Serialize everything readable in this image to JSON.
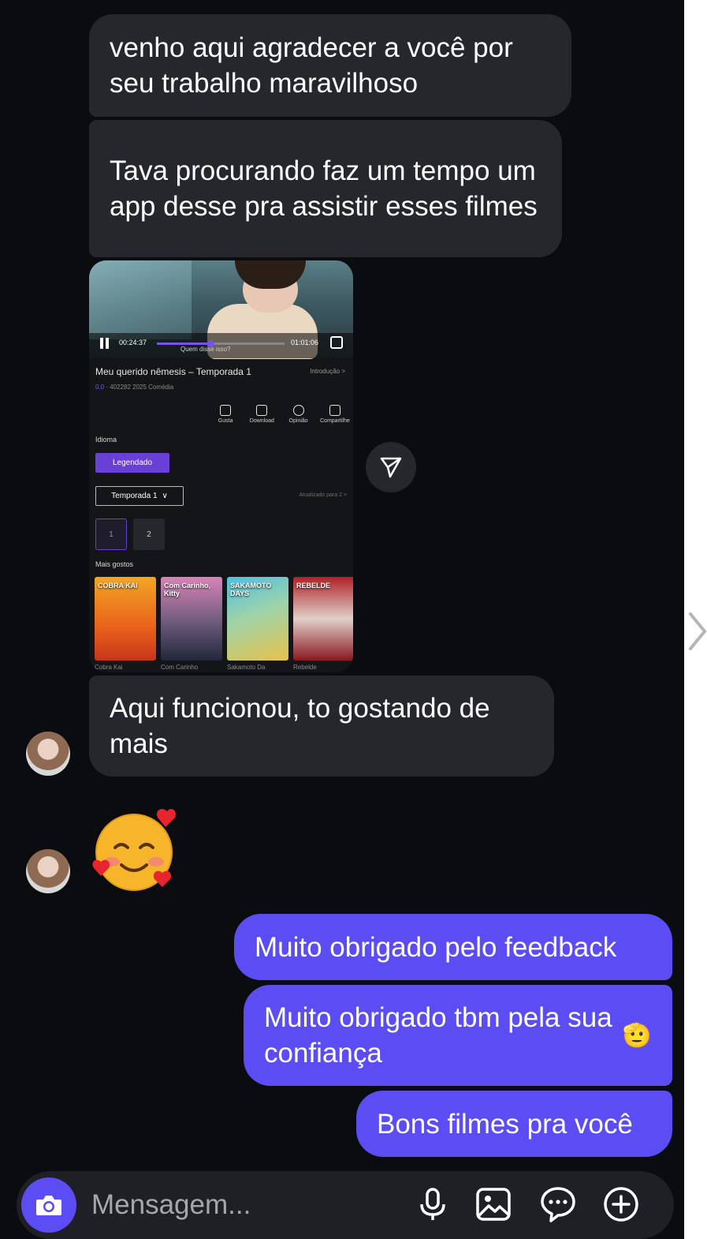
{
  "messages_incoming": [
    "venho aqui agradecer a você por seu trabalho maravilhoso",
    "Tava procurando faz um tempo um app desse pra assistir esses filmes",
    "Aqui funcionou, to gostando de mais"
  ],
  "reaction_emoji": "smiling-face-with-hearts",
  "messages_outgoing": [
    "Muito obrigado pelo feedback",
    "Muito obrigado tbm pela sua confiança",
    "Bons filmes pra você"
  ],
  "outgoing_emoji": "🫡",
  "shared_screenshot": {
    "video": {
      "elapsed": "00:24:37",
      "duration": "01:01:06",
      "subtitle": "Quem disse isso?",
      "progress": 0.42
    },
    "title": "Meu querido nêmesis – Temporada 1",
    "intro_link": "Introdução >",
    "rating": "0.0",
    "meta": "402282 2025 Comédia",
    "actions": [
      "Gusta",
      "Download",
      "Opinião",
      "Compartilhe"
    ],
    "language_label": "Idioma",
    "language_button": "Legendado",
    "season_select": "Temporada 1",
    "updated": "Atualizado para 2 >",
    "episodes": [
      "1",
      "2"
    ],
    "more_label": "Mais gostos",
    "posters": [
      {
        "title": "Cobra Kai",
        "art": "COBRA KAI"
      },
      {
        "title": "Com Carinho",
        "art": "Com Carinho, Kitty"
      },
      {
        "title": "Sakamoto Da",
        "art": "SAKAMOTO DAYS"
      },
      {
        "title": "Rebelde",
        "art": "REBELDE"
      }
    ]
  },
  "composer": {
    "placeholder": "Mensagem..."
  },
  "icons": [
    "camera-icon",
    "microphone-icon",
    "gallery-icon",
    "sticker-icon",
    "plus-circle-icon",
    "forward-icon",
    "chevron-right-icon"
  ],
  "colors": {
    "background": "#0b0c10",
    "incoming_bubble": "#26272d",
    "outgoing_bubble": "#5b4cf4",
    "accent": "#5b4cf4"
  }
}
